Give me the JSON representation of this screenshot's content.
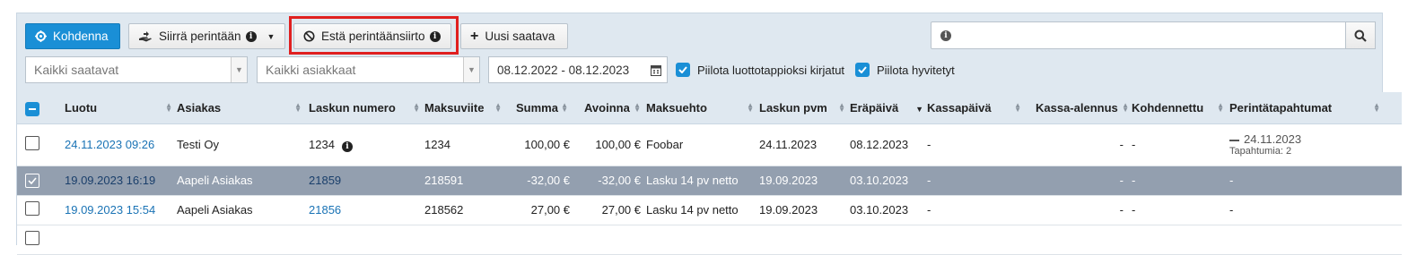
{
  "toolbar": {
    "kohdenna": "Kohdenna",
    "siirra": "Siirrä perintään",
    "esta": "Estä perintäänsiirto",
    "uusi": "Uusi saatava",
    "search_value": ""
  },
  "filters": {
    "saatavat": "Kaikki saatavat",
    "asiakkaat": "Kaikki asiakkaat",
    "date_range": "08.12.2022 - 08.12.2023",
    "piilota_luotto": "Piilota luottotappioksi kirjatut",
    "piilota_hyvitetyt": "Piilota hyvitetyt"
  },
  "table": {
    "headers": {
      "luotu": "Luotu",
      "asiakas": "Asiakas",
      "laskun_numero": "Laskun numero",
      "maksuviite": "Maksuviite",
      "summa": "Summa",
      "avoinna": "Avoinna",
      "maksuehto": "Maksuehto",
      "laskun_pvm": "Laskun pvm",
      "erapaiva": "Eräpäivä",
      "kassapaiva": "Kassapäivä",
      "kassa_alennus": "Kassa-alennus",
      "kohdennettu": "Kohdennettu",
      "perintatapahtumat": "Perintätapahtumat"
    },
    "rows": [
      {
        "luotu": "24.11.2023 09:26",
        "asiakas": "Testi Oy",
        "laskun_numero": "1234",
        "maksuviite": "1234",
        "summa": "100,00 €",
        "avoinna": "100,00 €",
        "maksuehto": "Foobar",
        "laskun_pvm": "24.11.2023",
        "erapaiva": "08.12.2023",
        "kassapaiva": "-",
        "kassa_alennus": "-",
        "kohdennettu": "-",
        "perinta": "24.11.2023",
        "perinta_sub": "Tapahtumia: 2"
      },
      {
        "luotu": "19.09.2023 16:19",
        "asiakas": "Aapeli Asiakas",
        "laskun_numero": "21859",
        "maksuviite": "218591",
        "summa": "-32,00 €",
        "avoinna": "-32,00 €",
        "maksuehto": "Lasku 14 pv netto",
        "laskun_pvm": "19.09.2023",
        "erapaiva": "03.10.2023",
        "kassapaiva": "-",
        "kassa_alennus": "-",
        "kohdennettu": "-",
        "perinta": "-"
      },
      {
        "luotu": "19.09.2023 15:54",
        "asiakas": "Aapeli Asiakas",
        "laskun_numero": "21856",
        "maksuviite": "218562",
        "summa": "27,00 €",
        "avoinna": "27,00 €",
        "maksuehto": "Lasku 14 pv netto",
        "laskun_pvm": "19.09.2023",
        "erapaiva": "03.10.2023",
        "kassapaiva": "-",
        "kassa_alennus": "-",
        "kohdennettu": "-",
        "perinta": "-"
      }
    ]
  },
  "colors": {
    "primary": "#1a8fd6",
    "selected_row": "#939faf",
    "highlight": "#e02020"
  }
}
